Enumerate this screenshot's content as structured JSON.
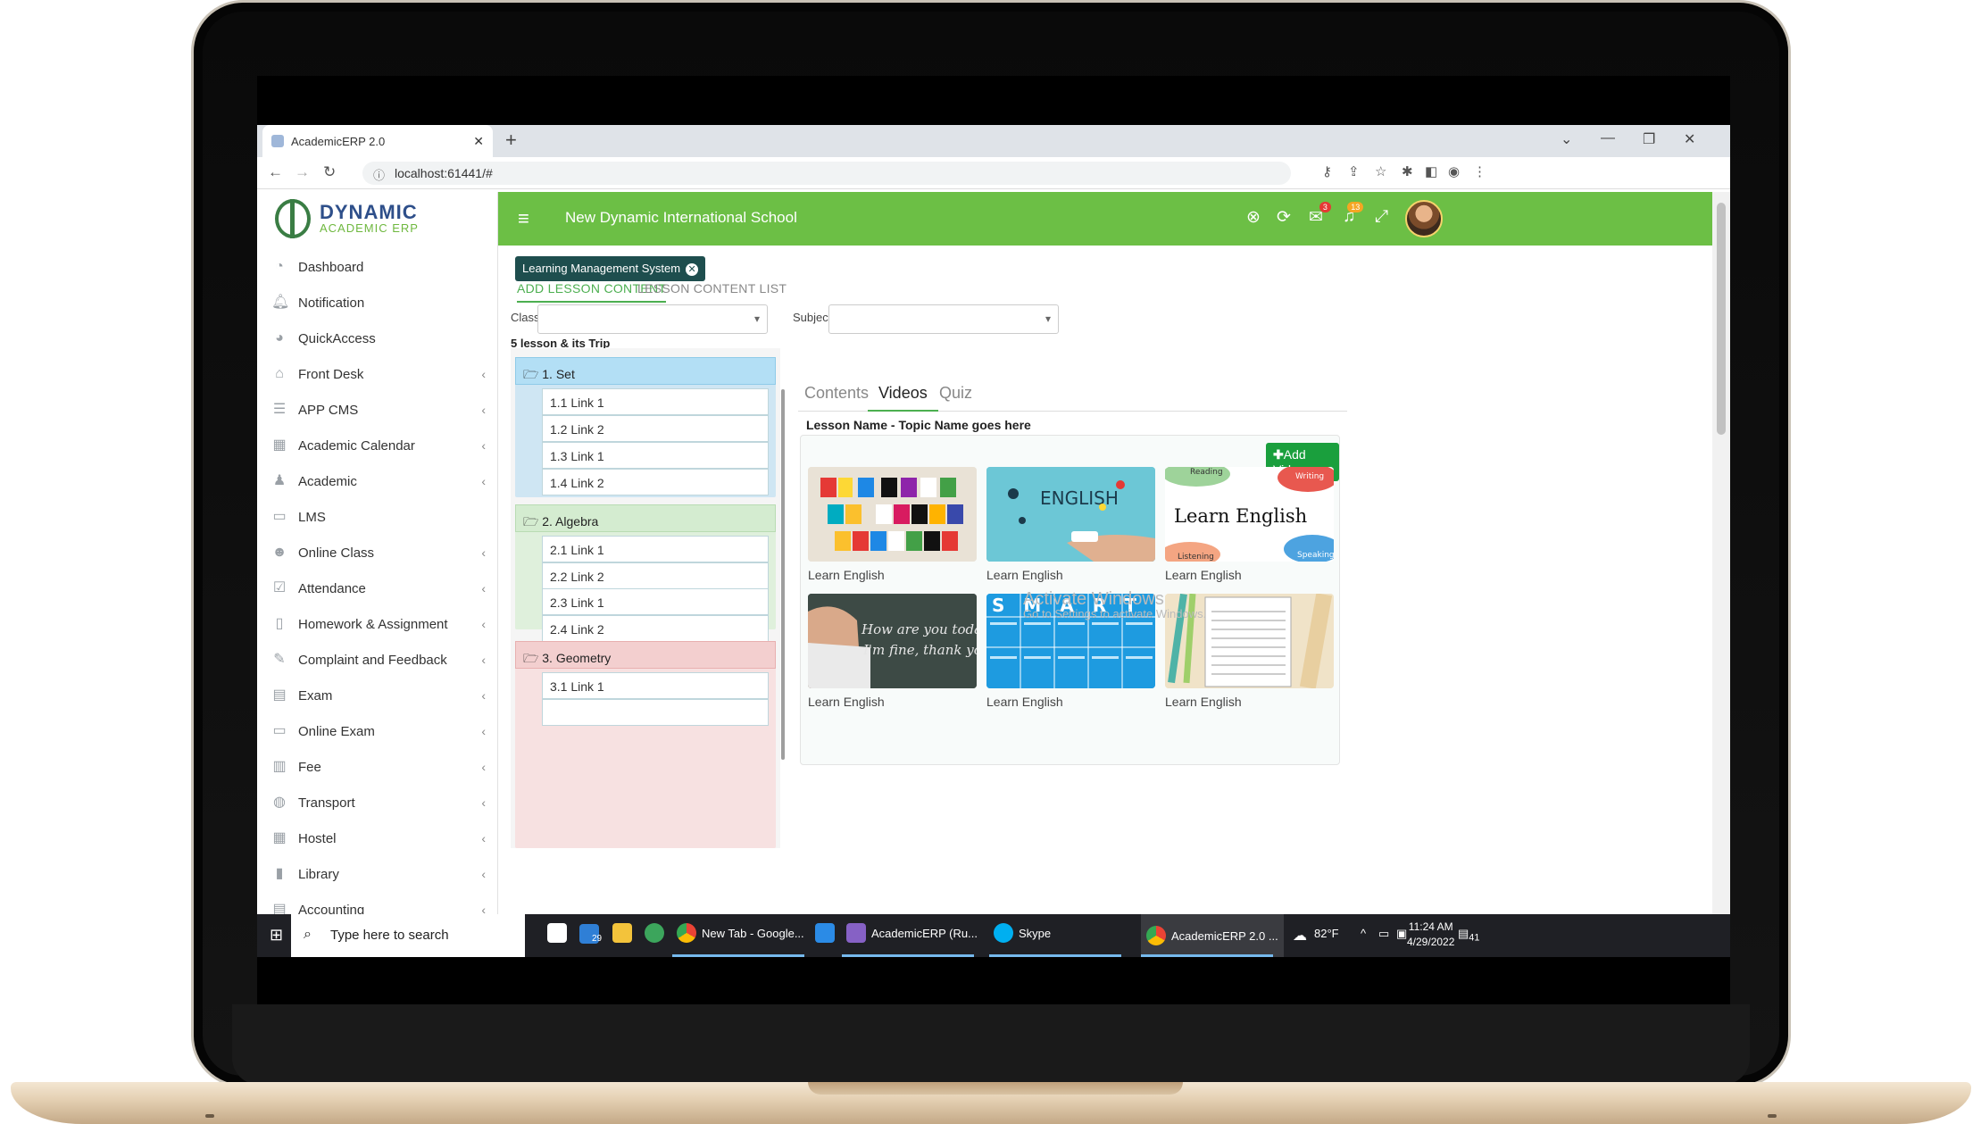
{
  "browser": {
    "tab_title": "AcademicERP 2.0",
    "url": "localhost:61441/#"
  },
  "logo": {
    "line1": "DYNAMIC",
    "line2": "ACADEMIC ERP"
  },
  "sidebar": {
    "items": [
      {
        "label": "Dashboard",
        "icon": "dashboard-icon",
        "chevron": false
      },
      {
        "label": "Notification",
        "icon": "bell-icon",
        "chevron": false
      },
      {
        "label": "QuickAccess",
        "icon": "speedometer-icon",
        "chevron": false
      },
      {
        "label": "Front Desk",
        "icon": "home-icon",
        "chevron": true
      },
      {
        "label": "APP CMS",
        "icon": "list-icon",
        "chevron": true
      },
      {
        "label": "Academic Calendar",
        "icon": "calendar-icon",
        "chevron": true
      },
      {
        "label": "Academic",
        "icon": "graduation-icon",
        "chevron": true
      },
      {
        "label": "LMS",
        "icon": "monitor-icon",
        "chevron": false
      },
      {
        "label": "Online Class",
        "icon": "users-icon",
        "chevron": true
      },
      {
        "label": "Attendance",
        "icon": "checkbox-icon",
        "chevron": true
      },
      {
        "label": "Homework & Assignment",
        "icon": "book-icon",
        "chevron": true
      },
      {
        "label": "Complaint and Feedback",
        "icon": "edit-icon",
        "chevron": true
      },
      {
        "label": "Exam",
        "icon": "exam-icon",
        "chevron": true
      },
      {
        "label": "Online Exam",
        "icon": "laptop-icon",
        "chevron": true
      },
      {
        "label": "Fee",
        "icon": "receipt-icon",
        "chevron": true
      },
      {
        "label": "Transport",
        "icon": "bus-icon",
        "chevron": true
      },
      {
        "label": "Hostel",
        "icon": "building-icon",
        "chevron": true
      },
      {
        "label": "Library",
        "icon": "library-icon",
        "chevron": true
      },
      {
        "label": "Accounting",
        "icon": "ledger-icon",
        "chevron": true
      }
    ]
  },
  "header": {
    "school": "New Dynamic International School",
    "messages_badge": "3",
    "alerts_badge": "13"
  },
  "lms_tag": "Learning Management System",
  "page_tabs": {
    "add": "ADD LESSON CONTENT",
    "list": "LESSON CONTENT LIST"
  },
  "filters": {
    "class_label": "Class",
    "class_value": "",
    "subject_label": "Subject",
    "subject_value": ""
  },
  "tree": {
    "heading": "5 lesson & its Trip",
    "groups": [
      {
        "title": "1. Set",
        "links": [
          "1.1 Link 1",
          "1.2 Link 2",
          "1.3 Link 1",
          "1.4 Link 2"
        ]
      },
      {
        "title": "2. Algebra",
        "links": [
          "2.1 Link 1",
          "2.2 Link 2",
          "2.3 Link 1",
          "2.4 Link 2"
        ]
      },
      {
        "title": "3. Geometry",
        "links": [
          "3.1 Link 1"
        ]
      }
    ]
  },
  "content_tabs": {
    "contents": "Contents",
    "videos": "Videos",
    "quiz": "Quiz"
  },
  "lesson_name": "Lesson Name - Topic Name goes here",
  "add_video": "Add Video",
  "videos": [
    {
      "caption": "Learn English"
    },
    {
      "caption": "Learn English"
    },
    {
      "caption": "Learn English"
    },
    {
      "caption": "Learn English"
    },
    {
      "caption": "Learn English"
    },
    {
      "caption": "Learn English"
    }
  ],
  "thumb_text": {
    "t2": "ENGLISH",
    "t3_title": "Learn English",
    "t3_reading": "Reading",
    "t3_writing": "Writing",
    "t3_listening": "Listening",
    "t3_speaking": "Speaking",
    "t4_line1": "How are you today?",
    "t4_line2": "I'm fine, thank you!",
    "t5": "SMART"
  },
  "watermark": {
    "title": "Activate Windows",
    "sub": "Go to Settings to activate Windows."
  },
  "taskbar": {
    "search_placeholder": "Type here to search",
    "mail_badge": "29",
    "chrome1": "New Tab - Google...",
    "vs": "AcademicERP (Ru...",
    "skype": "Skype",
    "chrome2": "AcademicERP 2.0 ...",
    "weather": "82°F",
    "time": "11:24 AM",
    "date": "4/29/2022",
    "notif_count": "41"
  }
}
